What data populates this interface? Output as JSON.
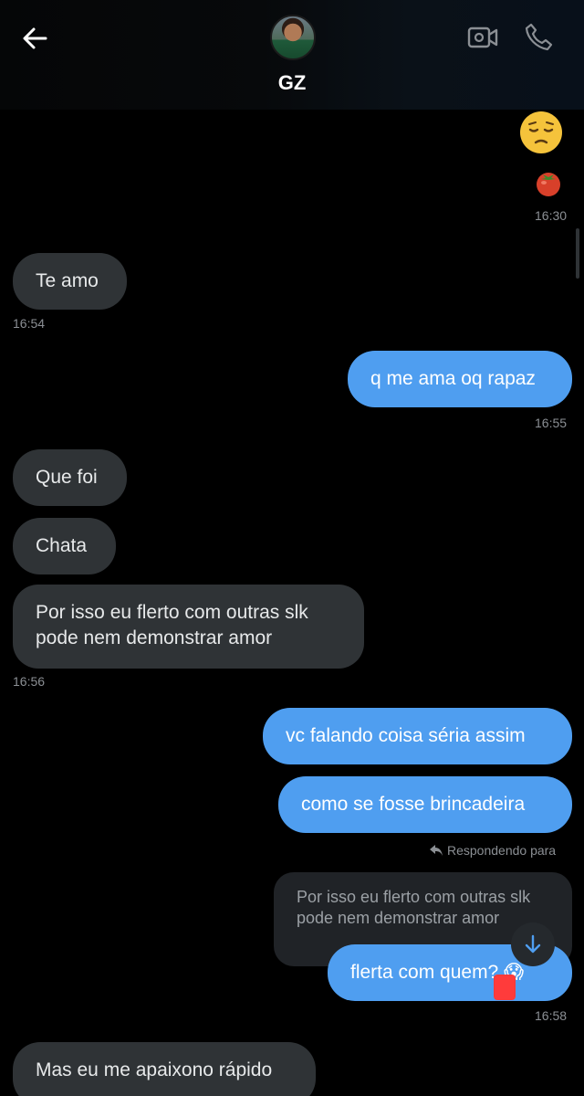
{
  "header": {
    "contact_name": "GZ",
    "back_icon": "arrow-left-icon",
    "video_icon": "video-call-icon",
    "call_icon": "phone-icon"
  },
  "messages": {
    "m0": {
      "emoji": "😔",
      "emoji2": "🍅",
      "time": "16:30"
    },
    "m1": {
      "text": "Te amo",
      "time": "16:54"
    },
    "m2": {
      "text": "q me ama oq rapaz",
      "time": "16:55"
    },
    "m3": {
      "text": "Que foi"
    },
    "m4": {
      "text": "Chata"
    },
    "m5": {
      "line1": "Por isso eu flerto com outras slk",
      "line2": "pode nem demonstrar amor",
      "time": "16:56"
    },
    "m6": {
      "text": "vc falando coisa séria assim"
    },
    "m7": {
      "text": "como se fosse brincadeira"
    },
    "m8": {
      "reply_label": "Respondendo para",
      "quoted": "Por isso eu flerto com outras slk\npode nem demonstrar amor",
      "text": "flerta com quem? 😱",
      "time": "16:58"
    },
    "m9": {
      "text": "Mas eu me apaixono rápido"
    }
  },
  "colors": {
    "incoming_bubble": "#2f3336",
    "outgoing_bubble": "#4f9ef0",
    "background": "#000000"
  }
}
